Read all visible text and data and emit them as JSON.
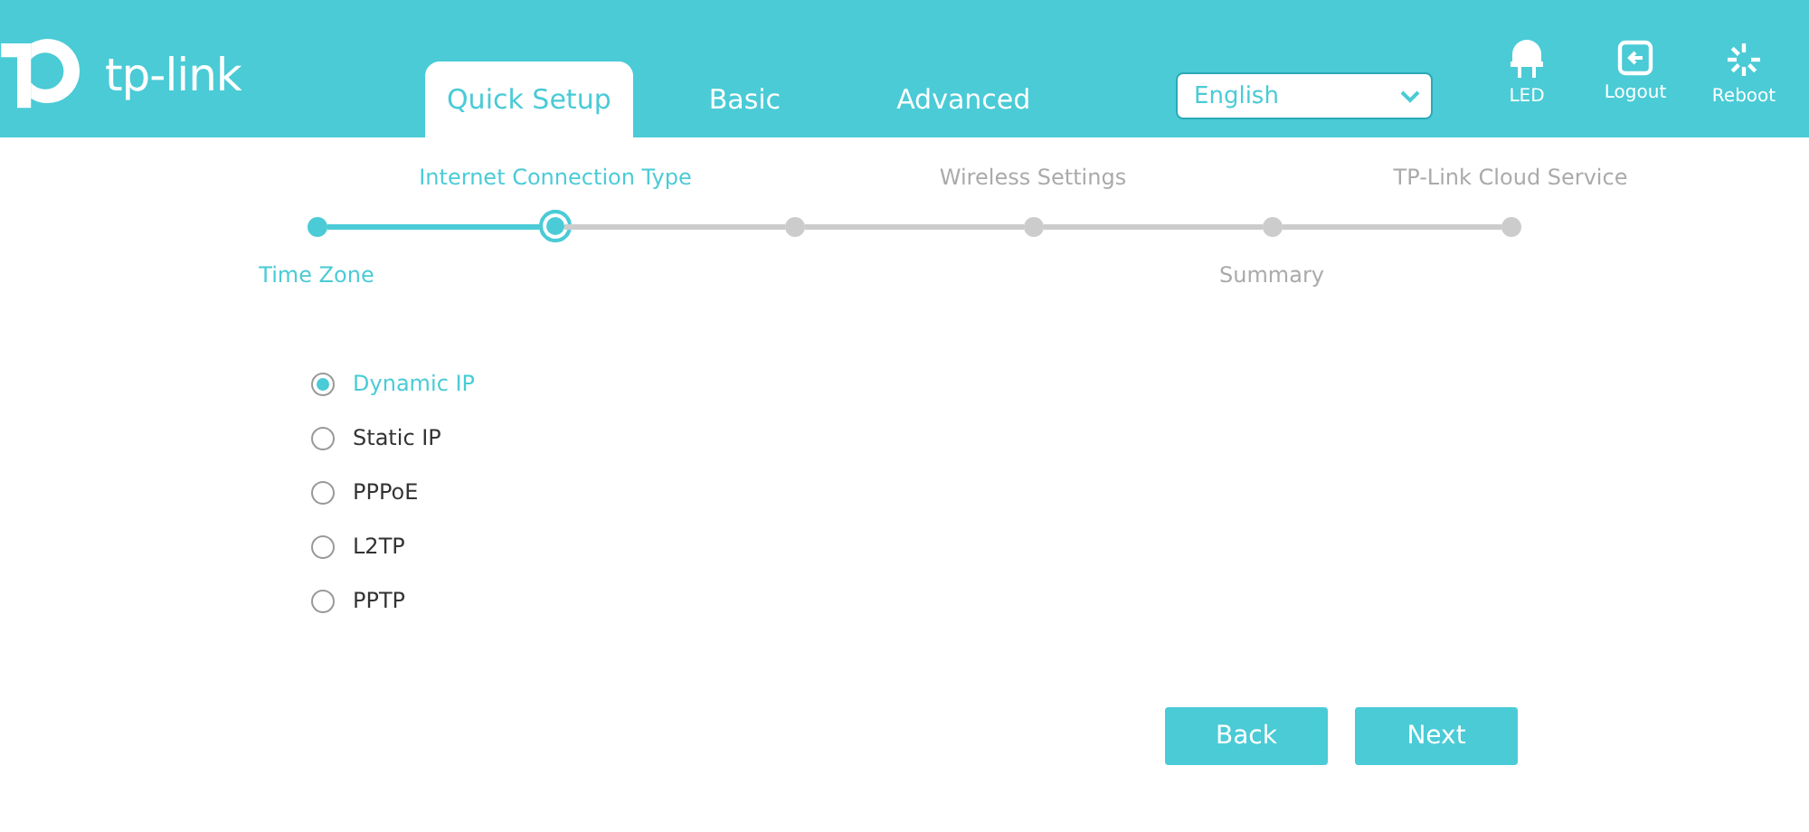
{
  "header": {
    "logo": "tp-link",
    "tabs": [
      {
        "label": "Quick Setup",
        "selected": true
      },
      {
        "label": "Basic",
        "selected": false
      },
      {
        "label": "Advanced",
        "selected": false
      }
    ],
    "language": {
      "value": "English"
    },
    "actions": [
      {
        "kind": "led",
        "label": "LED"
      },
      {
        "kind": "logout",
        "label": "Logout"
      },
      {
        "kind": "reboot",
        "label": "Reboot"
      }
    ]
  },
  "steps": [
    {
      "label_below": "Time Zone",
      "kind": "done"
    },
    {
      "label_above": "Internet Connection Type",
      "kind": "current"
    },
    {
      "kind": "todo"
    },
    {
      "label_above": "Wireless Settings",
      "kind": "todo"
    },
    {
      "label_below": "Summary",
      "kind": "todo"
    },
    {
      "label_above": "TP-Link Cloud Service",
      "kind": "todo"
    }
  ],
  "connection_types": [
    {
      "label": "Dynamic IP",
      "selected": true
    },
    {
      "label": "Static IP",
      "selected": false
    },
    {
      "label": "PPPoE",
      "selected": false
    },
    {
      "label": "L2TP",
      "selected": false
    },
    {
      "label": "PPTP",
      "selected": false
    }
  ],
  "buttons": [
    "Back",
    "Next"
  ]
}
